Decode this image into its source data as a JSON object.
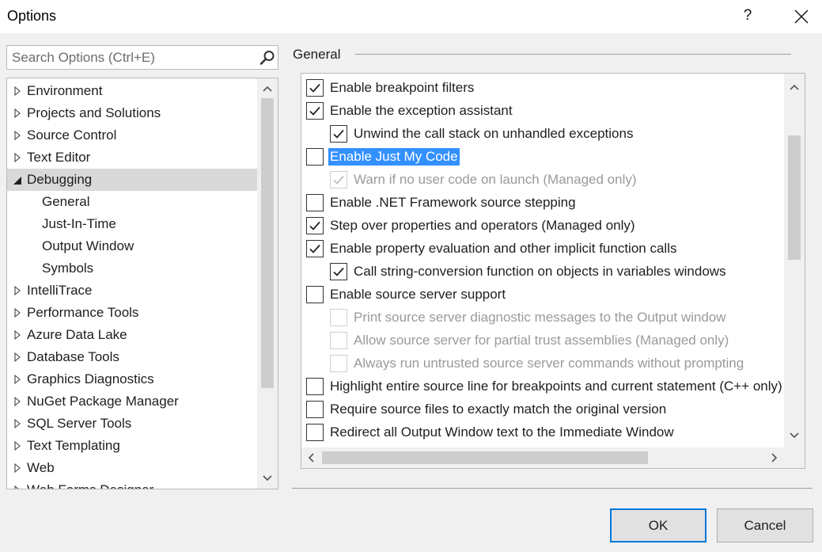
{
  "window": {
    "title": "Options",
    "help_label": "?"
  },
  "search": {
    "placeholder": "Search Options (Ctrl+E)"
  },
  "tree": {
    "items": [
      {
        "label": "Environment",
        "level": 0,
        "expandable": true,
        "expanded": false
      },
      {
        "label": "Projects and Solutions",
        "level": 0,
        "expandable": true,
        "expanded": false
      },
      {
        "label": "Source Control",
        "level": 0,
        "expandable": true,
        "expanded": false
      },
      {
        "label": "Text Editor",
        "level": 0,
        "expandable": true,
        "expanded": false
      },
      {
        "label": "Debugging",
        "level": 0,
        "expandable": true,
        "expanded": true,
        "selected": true
      },
      {
        "label": "General",
        "level": 1,
        "expandable": false
      },
      {
        "label": "Just-In-Time",
        "level": 1,
        "expandable": false
      },
      {
        "label": "Output Window",
        "level": 1,
        "expandable": false
      },
      {
        "label": "Symbols",
        "level": 1,
        "expandable": false
      },
      {
        "label": "IntelliTrace",
        "level": 0,
        "expandable": true,
        "expanded": false
      },
      {
        "label": "Performance Tools",
        "level": 0,
        "expandable": true,
        "expanded": false
      },
      {
        "label": "Azure Data Lake",
        "level": 0,
        "expandable": true,
        "expanded": false
      },
      {
        "label": "Database Tools",
        "level": 0,
        "expandable": true,
        "expanded": false
      },
      {
        "label": "Graphics Diagnostics",
        "level": 0,
        "expandable": true,
        "expanded": false
      },
      {
        "label": "NuGet Package Manager",
        "level": 0,
        "expandable": true,
        "expanded": false
      },
      {
        "label": "SQL Server Tools",
        "level": 0,
        "expandable": true,
        "expanded": false
      },
      {
        "label": "Text Templating",
        "level": 0,
        "expandable": true,
        "expanded": false
      },
      {
        "label": "Web",
        "level": 0,
        "expandable": true,
        "expanded": false
      },
      {
        "label": "Web Forms Designer",
        "level": 0,
        "expandable": true,
        "expanded": false
      }
    ]
  },
  "group": {
    "header": "General"
  },
  "options": [
    {
      "label": "Enable breakpoint filters",
      "checked": true,
      "disabled": false,
      "indent": 0
    },
    {
      "label": "Enable the exception assistant",
      "checked": true,
      "disabled": false,
      "indent": 0
    },
    {
      "label": "Unwind the call stack on unhandled exceptions",
      "checked": true,
      "disabled": false,
      "indent": 1
    },
    {
      "label": "Enable Just My Code",
      "checked": false,
      "disabled": false,
      "indent": 0,
      "highlighted": true
    },
    {
      "label": "Warn if no user code on launch (Managed only)",
      "checked": true,
      "disabled": true,
      "indent": 1
    },
    {
      "label": "Enable .NET Framework source stepping",
      "checked": false,
      "disabled": false,
      "indent": 0
    },
    {
      "label": "Step over properties and operators (Managed only)",
      "checked": true,
      "disabled": false,
      "indent": 0
    },
    {
      "label": "Enable property evaluation and other implicit function calls",
      "checked": true,
      "disabled": false,
      "indent": 0
    },
    {
      "label": "Call string-conversion function on objects in variables windows",
      "checked": true,
      "disabled": false,
      "indent": 1
    },
    {
      "label": "Enable source server support",
      "checked": false,
      "disabled": false,
      "indent": 0
    },
    {
      "label": "Print source server diagnostic messages to the Output window",
      "checked": false,
      "disabled": true,
      "indent": 1
    },
    {
      "label": "Allow source server for partial trust assemblies (Managed only)",
      "checked": false,
      "disabled": true,
      "indent": 1
    },
    {
      "label": "Always run untrusted source server commands without prompting",
      "checked": false,
      "disabled": true,
      "indent": 1
    },
    {
      "label": "Highlight entire source line for breakpoints and current statement (C++ only)",
      "checked": false,
      "disabled": false,
      "indent": 0
    },
    {
      "label": "Require source files to exactly match the original version",
      "checked": false,
      "disabled": false,
      "indent": 0
    },
    {
      "label": "Redirect all Output Window text to the Immediate Window",
      "checked": false,
      "disabled": false,
      "indent": 0
    }
  ],
  "buttons": {
    "ok": "OK",
    "cancel": "Cancel"
  },
  "colors": {
    "selection_highlight": "#3390ff",
    "tree_selected": "#d9d9d9",
    "default_button_border": "#0078d7"
  },
  "icons": {
    "close": "close-icon",
    "search": "search-icon",
    "tree_collapsed": "triangle-right-icon",
    "tree_expanded": "triangle-down-icon",
    "check": "check-icon"
  }
}
